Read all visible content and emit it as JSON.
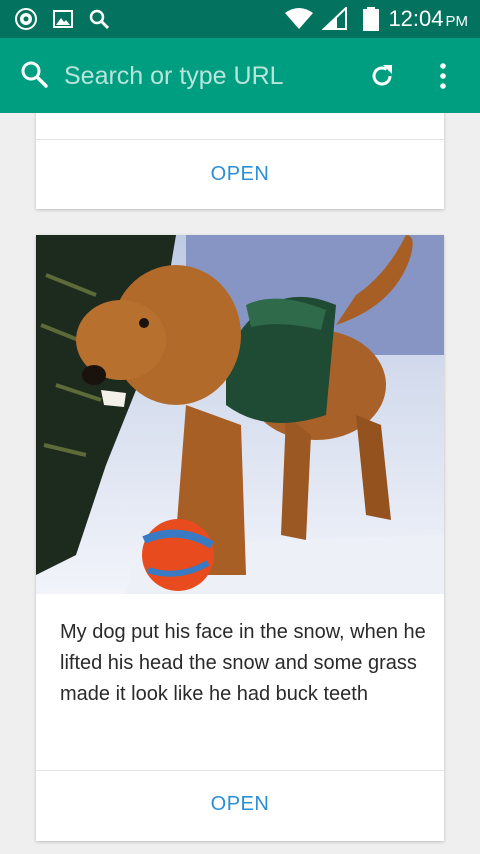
{
  "status_bar": {
    "time": "12:04",
    "ampm": "PM",
    "icons": [
      "app-notification-icon",
      "image-notification-icon",
      "search-notification-icon",
      "wifi-icon",
      "cell-signal-icon",
      "battery-icon"
    ]
  },
  "toolbar": {
    "search_placeholder": "Search or type URL",
    "icons": [
      "search-icon",
      "refresh-icon",
      "overflow-menu-icon"
    ]
  },
  "cards": [
    {
      "open_label": "OPEN"
    },
    {
      "image_subject": "dog-in-snow-photo",
      "caption": "My dog put his face in the snow, when he lifted his head the snow and some grass made it look like he had buck teeth",
      "open_label": "OPEN"
    }
  ],
  "colors": {
    "status_bar": "#03735f",
    "toolbar": "#009e80",
    "link": "#2b8fd6",
    "background": "#efefef"
  }
}
